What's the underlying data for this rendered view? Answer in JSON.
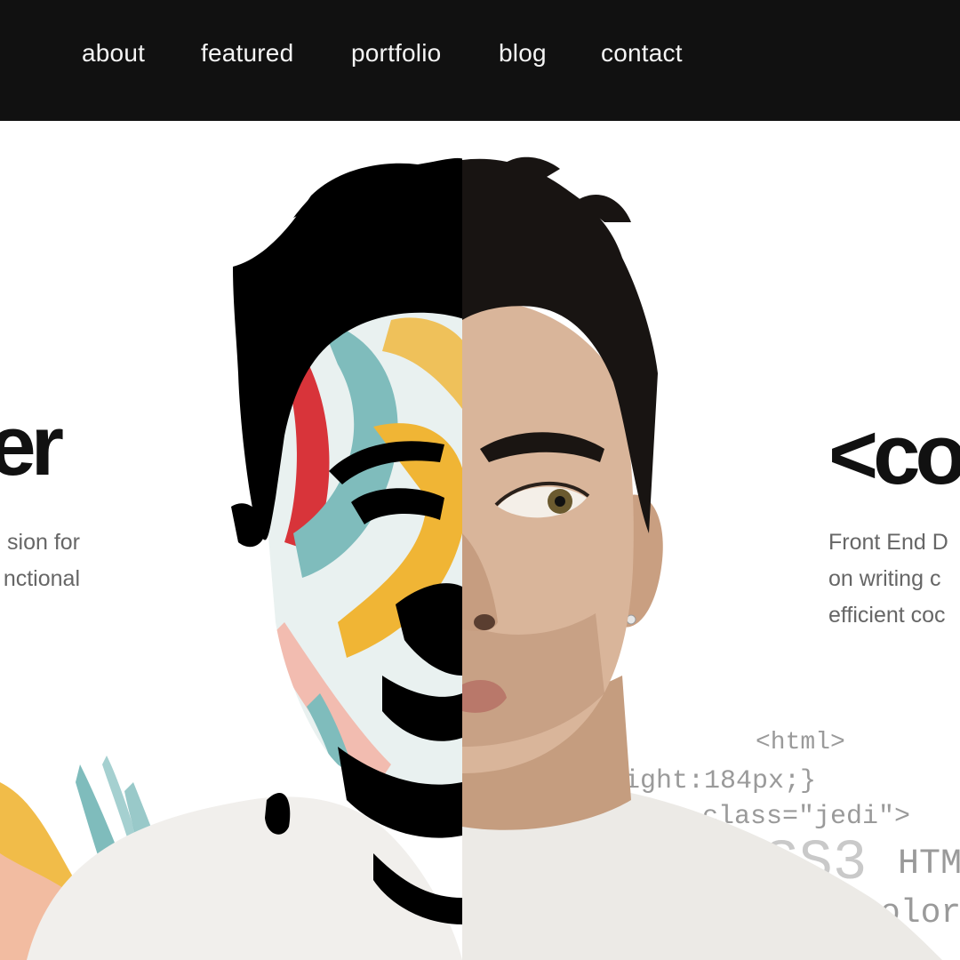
{
  "nav": {
    "items": [
      "about",
      "featured",
      "portfolio",
      "blog",
      "contact"
    ]
  },
  "hero": {
    "left_heading": "er",
    "left_text": [
      "sion for",
      "nctional"
    ],
    "right_heading": "<co",
    "right_text": [
      "Front End D",
      "on writing c",
      "efficient coc"
    ],
    "code_lines": [
      "<html>",
      "eight:184px;}",
      "class=\"jedi\">",
      "SS3",
      "HTM",
      "olor:"
    ]
  },
  "colors": {
    "nav_bg": "#111111",
    "nav_text": "#f4f4f4",
    "heading": "#111111",
    "body_text": "#666666",
    "code_text": "#9a9a9a",
    "paint_red": "#d8343a",
    "paint_teal": "#7fbcbc",
    "paint_yellow": "#f0b535",
    "paint_pink": "#f2bcb0"
  }
}
